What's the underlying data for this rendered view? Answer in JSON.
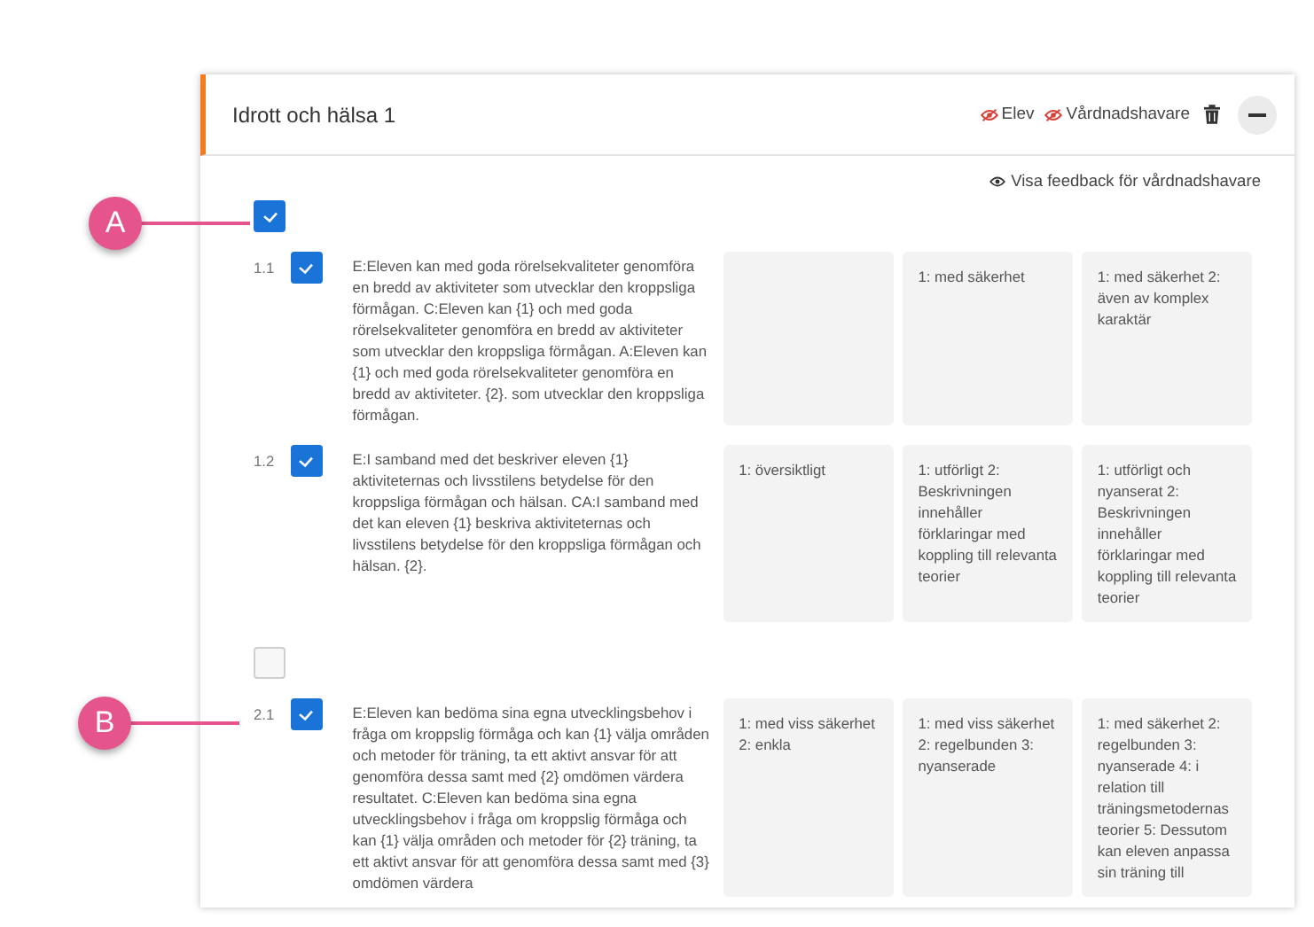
{
  "panel": {
    "title": "Idrott och hälsa 1",
    "visibility": [
      {
        "label": "Elev",
        "hidden": true
      },
      {
        "label": "Vårdnadshavare",
        "hidden": true
      }
    ],
    "feedback_link": "Visa feedback för vårdnadshavare",
    "groups": [
      {
        "checked": true,
        "rows": [
          {
            "number": "1.1",
            "checked": true,
            "text": "E:Eleven kan med goda rörelsekvaliteter genomföra en bredd av aktiviteter som utvecklar den kroppsliga förmågan. C:Eleven kan {1} och med goda rörelsekvaliteter genomföra en bredd av aktiviteter som utvecklar den kroppsliga förmågan. A:Eleven kan {1} och med goda rörelsekvaliteter genomföra en bredd av aktiviteter. {2}. som utvecklar den kroppsliga förmågan.",
            "cells": [
              {
                "kind": "empty"
              },
              {
                "kind": "text",
                "text": "1: med säkerhet"
              },
              {
                "kind": "text",
                "text": "1: med säkerhet 2: även av komplex karaktär"
              }
            ]
          },
          {
            "number": "1.2",
            "checked": true,
            "text": "E:I samband med det beskriver eleven {1} aktiviteternas och livsstilens betydelse för den kroppsliga förmågan och hälsan. CA:I samband med det kan eleven {1} beskriva aktiviteternas och livsstilens betydelse för den kroppsliga förmågan och hälsan. {2}.",
            "cells": [
              {
                "kind": "text",
                "text": "1: översiktligt"
              },
              {
                "kind": "text",
                "text": "1: utförligt 2: Beskrivningen innehåller förklaringar med koppling till relevanta teorier"
              },
              {
                "kind": "text",
                "text": "1: utförligt och nyanserat 2: Beskrivningen innehåller förklaringar med koppling till relevanta teorier"
              }
            ]
          }
        ]
      },
      {
        "checked": false,
        "rows": [
          {
            "number": "2.1",
            "checked": true,
            "text": "E:Eleven kan bedöma sina egna utvecklingsbehov i fråga om kroppslig förmåga och kan {1} välja områden och metoder för träning, ta ett aktivt ansvar för att genomföra dessa samt med {2} omdömen värdera resultatet. C:Eleven kan bedöma sina egna utvecklingsbehov i fråga om kroppslig förmåga och kan {1} välja områden och metoder för {2} träning, ta ett aktivt ansvar för att genomföra dessa samt med {3} omdömen värdera",
            "cells": [
              {
                "kind": "text",
                "text": "1: med viss säkerhet 2: enkla"
              },
              {
                "kind": "text",
                "text": "1: med viss säkerhet 2: regelbunden 3: nyanserade"
              },
              {
                "kind": "text",
                "text": "1: med säkerhet 2: regelbunden 3: nyanserade 4: i relation till träningsmetodernas teorier 5: Dessutom kan eleven anpassa sin träning till"
              }
            ]
          }
        ]
      }
    ]
  },
  "callouts": [
    {
      "label": "A"
    },
    {
      "label": "B"
    }
  ]
}
